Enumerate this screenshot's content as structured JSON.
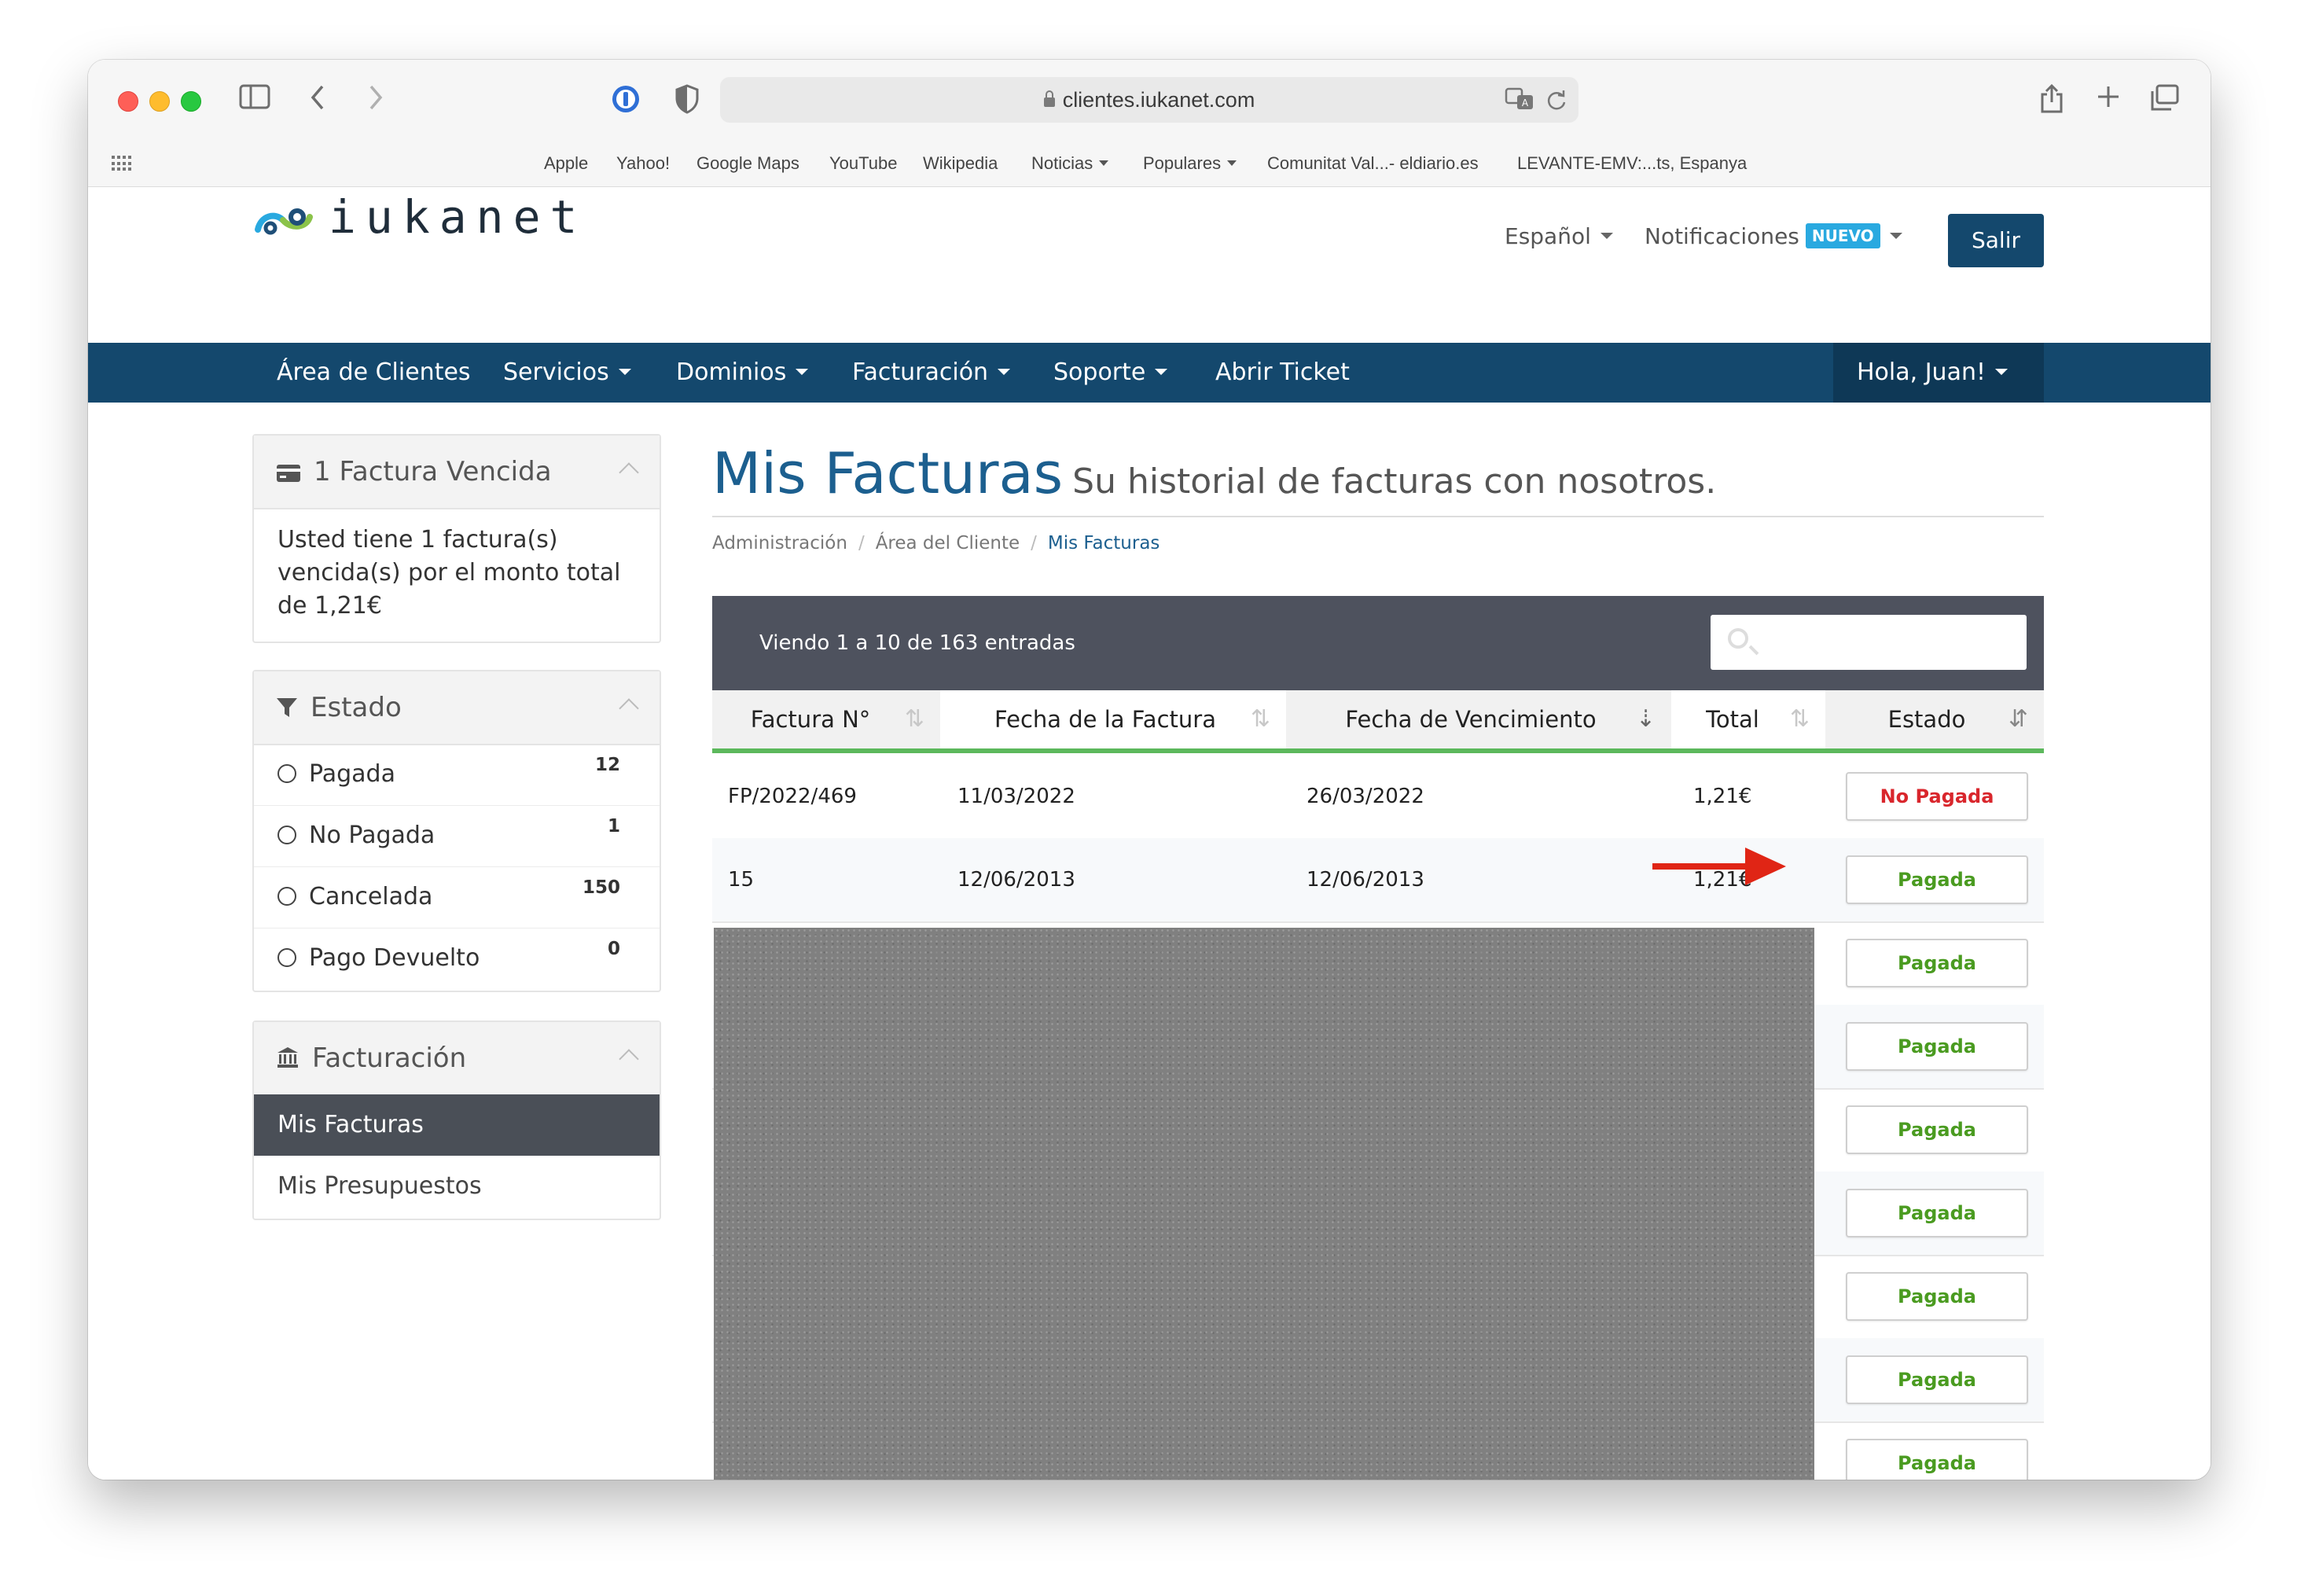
{
  "browser": {
    "url": "clientes.iukanet.com",
    "favorites": [
      "Apple",
      "Yahoo!",
      "Google Maps",
      "YouTube",
      "Wikipedia",
      "Noticias",
      "Populares",
      "Comunitat Val...- eldiario.es",
      "LEVANTE-EMV:...ts, Espanya"
    ]
  },
  "header": {
    "logo_text": "iukanet",
    "language": "Español",
    "notifications": "Notificaciones",
    "new_badge": "NUEVO",
    "logout": "Salir"
  },
  "nav": {
    "items": [
      "Área de Clientes",
      "Servicios",
      "Dominios",
      "Facturación",
      "Soporte",
      "Abrir Ticket"
    ],
    "user": "Hola, Juan!"
  },
  "sidebar": {
    "overdue": {
      "title": "1 Factura Vencida",
      "body": "Usted tiene 1 factura(s) vencida(s) por el monto total de 1,21€"
    },
    "status_filter": {
      "title": "Estado",
      "options": [
        {
          "label": "Pagada",
          "count": "12"
        },
        {
          "label": "No Pagada",
          "count": "1"
        },
        {
          "label": "Cancelada",
          "count": "150"
        },
        {
          "label": "Pago Devuelto",
          "count": "0"
        }
      ]
    },
    "billing": {
      "title": "Facturación",
      "items": [
        "Mis Facturas",
        "Mis Presupuestos"
      ]
    }
  },
  "main": {
    "title": "Mis Facturas",
    "subtitle": "Su historial de facturas con nosotros.",
    "breadcrumb": [
      "Administración",
      "Área del Cliente",
      "Mis Facturas"
    ],
    "viewing": "Viendo 1 a 10 de 163 entradas",
    "search_value": "",
    "columns": [
      "Factura N°",
      "Fecha de la Factura",
      "Fecha de Vencimiento",
      "Total",
      "Estado"
    ],
    "rows": [
      {
        "invoice": "FP/2022/469",
        "date": "11/03/2022",
        "due": "26/03/2022",
        "total": "1,21€",
        "status": "No Pagada"
      },
      {
        "invoice": "15",
        "date": "12/06/2013",
        "due": "12/06/2013",
        "total": "1,21€",
        "status": "Pagada"
      },
      {
        "status": "Pagada"
      },
      {
        "status": "Pagada"
      },
      {
        "status": "Pagada"
      },
      {
        "status": "Pagada"
      },
      {
        "status": "Pagada"
      },
      {
        "status": "Pagada"
      },
      {
        "status": "Pagada"
      }
    ]
  },
  "colors": {
    "brand": "#14486d",
    "title": "#1c5f8f",
    "paid": "#4a9b20",
    "unpaid": "#d9262c",
    "arrow": "#e02515"
  }
}
